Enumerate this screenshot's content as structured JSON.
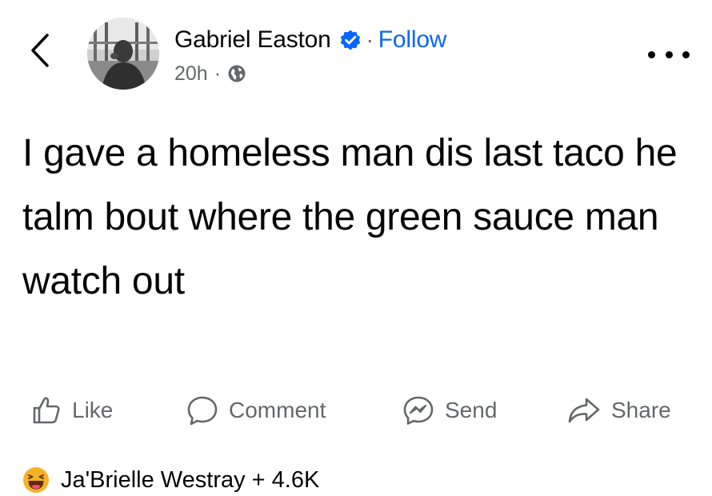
{
  "header": {
    "author_name": "Gabriel Easton",
    "follow_separator": "·",
    "follow_label": "Follow",
    "timestamp": "20h",
    "meta_separator": "·",
    "privacy_icon": "globe-icon",
    "verified_icon": "verified-badge-icon",
    "back_icon": "chevron-left-icon",
    "more_icon": "more-options-icon"
  },
  "post": {
    "text": "I gave a homeless man dis last taco he talm bout where the green sauce man watch out"
  },
  "actions": {
    "like_label": "Like",
    "comment_label": "Comment",
    "send_label": "Send",
    "share_label": "Share"
  },
  "reactions": {
    "icon": "haha-reaction-icon",
    "summary": "Ja'Brielle Westray + 4.6K"
  },
  "colors": {
    "text": "#050505",
    "secondary": "#65676b",
    "accent": "#0866ff",
    "reaction_yellow": "#f7b125"
  }
}
